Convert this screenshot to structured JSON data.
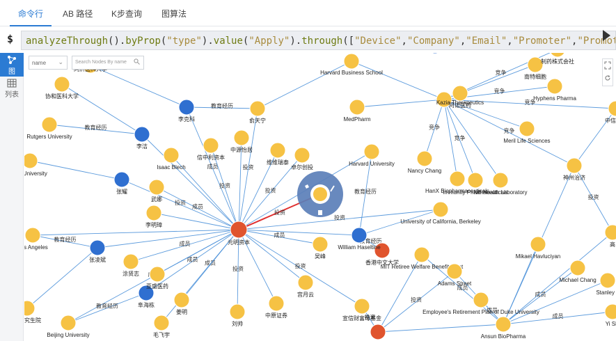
{
  "tabs": [
    {
      "label": "命令行",
      "active": true
    },
    {
      "label": "AB 路径",
      "active": false
    },
    {
      "label": "K步查询",
      "active": false
    },
    {
      "label": "图算法",
      "active": false
    }
  ],
  "command": {
    "prompt": "$",
    "parts": [
      {
        "t": "analyzeThrough",
        "c": "fn"
      },
      {
        "t": "().",
        "c": "p"
      },
      {
        "t": "byProp",
        "c": "fn"
      },
      {
        "t": "(",
        "c": "p"
      },
      {
        "t": "\"type\"",
        "c": "str"
      },
      {
        "t": ").",
        "c": "p"
      },
      {
        "t": "value",
        "c": "fn"
      },
      {
        "t": "(",
        "c": "p"
      },
      {
        "t": "\"Apply\"",
        "c": "str"
      },
      {
        "t": ").",
        "c": "p"
      },
      {
        "t": "through",
        "c": "fn"
      },
      {
        "t": "([",
        "c": "p"
      },
      {
        "t": "\"Device\"",
        "c": "str"
      },
      {
        "t": ",",
        "c": "p"
      },
      {
        "t": "\"Company\"",
        "c": "str"
      },
      {
        "t": ",",
        "c": "p"
      },
      {
        "t": "\"Email\"",
        "c": "str"
      },
      {
        "t": ",",
        "c": "p"
      },
      {
        "t": "\"Promoter\"",
        "c": "str"
      },
      {
        "t": ",",
        "c": "p"
      },
      {
        "t": "\"PromoterAp",
        "c": "str"
      }
    ]
  },
  "sidebar": [
    {
      "icon": "graph-icon",
      "label": "图",
      "active": true
    },
    {
      "icon": "table-icon",
      "label": "列表",
      "active": false
    }
  ],
  "filter": {
    "select_value": "name",
    "search_placeholder": "Search Nodes By name"
  },
  "colors": {
    "company": "#f6c244",
    "person": "#2f6fd0",
    "center": "#e0542e",
    "edge": "#4a90d9",
    "highlight": "#e03030"
  },
  "graph": {
    "nodes": [
      {
        "id": "center",
        "label": "元明资本",
        "kind": "center"
      },
      {
        "id": "c2",
        "label": "香港中文大学",
        "kind": "center"
      },
      {
        "id": "c3",
        "label": "",
        "kind": "center"
      },
      {
        "id": "kazia",
        "label": "Kazia Therapeutics",
        "kind": "company"
      },
      {
        "id": "wh",
        "label": "William Haseltine",
        "kind": "person"
      },
      {
        "id": "ansun",
        "label": "Ansun BioPharma",
        "kind": "company"
      },
      {
        "id": "sel",
        "label": "",
        "kind": "company"
      },
      {
        "id": "lkl",
        "label": "李克科",
        "kind": "person"
      },
      {
        "id": "lj",
        "label": "李洁",
        "kind": "person"
      },
      {
        "id": "zy",
        "label": "张耀",
        "kind": "person"
      },
      {
        "id": "zlb",
        "label": "张凌斌",
        "kind": "person"
      },
      {
        "id": "bhd",
        "label": "阜海栋",
        "kind": "person"
      },
      {
        "id": "p1",
        "label": "",
        "kind": "person"
      },
      {
        "id": "n1",
        "label": "同济医科大学",
        "kind": "company"
      },
      {
        "id": "n2",
        "label": "协和医科大学",
        "kind": "company"
      },
      {
        "id": "n3",
        "label": "Rutgers University",
        "kind": "company"
      },
      {
        "id": "n4",
        "label": "nell University",
        "kind": "company"
      },
      {
        "id": "n5",
        "label": "Isaac Blech",
        "kind": "company"
      },
      {
        "id": "n6",
        "label": "信中利资本",
        "kind": "company"
      },
      {
        "id": "n7",
        "label": "中源怡居",
        "kind": "company"
      },
      {
        "id": "n8",
        "label": "俞天宁",
        "kind": "company"
      },
      {
        "id": "n9",
        "label": "Harvard Business School",
        "kind": "company"
      },
      {
        "id": "n10",
        "label": "MedPharm",
        "kind": "company"
      },
      {
        "id": "n11",
        "label": "维维瑞泰",
        "kind": "company"
      },
      {
        "id": "n12",
        "label": "卓尔创投",
        "kind": "company"
      },
      {
        "id": "n13",
        "label": "Harvard University",
        "kind": "company"
      },
      {
        "id": "n14",
        "label": "Nancy Chang",
        "kind": "company"
      },
      {
        "id": "n15",
        "label": "武娜",
        "kind": "company"
      },
      {
        "id": "n16",
        "label": "李明璋",
        "kind": "company"
      },
      {
        "id": "n17",
        "label": "Los Angeles",
        "kind": "company"
      },
      {
        "id": "n18",
        "label": "涂贤志",
        "kind": "company"
      },
      {
        "id": "n19",
        "label": "亚盛医药",
        "kind": "company"
      },
      {
        "id": "n20",
        "label": "吴峰",
        "kind": "company"
      },
      {
        "id": "n21",
        "label": "宫月云",
        "kind": "company"
      },
      {
        "id": "n22",
        "label": "姜明",
        "kind": "company"
      },
      {
        "id": "n23",
        "label": "毛飞宇",
        "kind": "company"
      },
      {
        "id": "n24",
        "label": "Beijing University",
        "kind": "company"
      },
      {
        "id": "n25",
        "label": "院研究生院",
        "kind": "company"
      },
      {
        "id": "n26",
        "label": "刘帅",
        "kind": "company"
      },
      {
        "id": "n27",
        "label": "中原证券",
        "kind": "company"
      },
      {
        "id": "n28",
        "label": "宣信财富母基金",
        "kind": "company"
      },
      {
        "id": "n29",
        "label": "MIT Retiree Welfare Benefit Trust",
        "kind": "company"
      },
      {
        "id": "n30",
        "label": "Adams Street",
        "kind": "company"
      },
      {
        "id": "n31",
        "label": "Employee's Retirement Plan of Duke University",
        "kind": "company"
      },
      {
        "id": "n32",
        "label": "University of California, Berkeley",
        "kind": "company"
      },
      {
        "id": "n33",
        "label": "HanX Biopharmaceuticals",
        "kind": "company"
      },
      {
        "id": "n34",
        "label": "Immunity Pharmaceuticals",
        "kind": "company"
      },
      {
        "id": "n35",
        "label": "NB Health Laboratory",
        "kind": "company"
      },
      {
        "id": "n36",
        "label": "神州治济",
        "kind": "company"
      },
      {
        "id": "n37",
        "label": "Meril Life Sciences",
        "kind": "company"
      },
      {
        "id": "n38",
        "label": "Hyphens Pharma",
        "kind": "company"
      },
      {
        "id": "n39",
        "label": "南特细胞",
        "kind": "company"
      },
      {
        "id": "n40",
        "label": "制药株式会社",
        "kind": "company"
      },
      {
        "id": "n41",
        "label": "阿诺医药",
        "kind": "company"
      },
      {
        "id": "n42",
        "label": "Mikael Havluciyan",
        "kind": "company"
      },
      {
        "id": "n43",
        "label": "Michael Chang",
        "kind": "company"
      },
      {
        "id": "n44",
        "label": "Stanley L",
        "kind": "company"
      },
      {
        "id": "n45",
        "label": "Yi Shi",
        "kind": "company"
      },
      {
        "id": "n46",
        "label": "高",
        "kind": "company"
      },
      {
        "id": "n47",
        "label": "中信产业",
        "kind": "company"
      }
    ],
    "edges": [
      {
        "label": "教育经历"
      },
      {
        "label": "投资"
      },
      {
        "label": "成员"
      },
      {
        "label": "竞争"
      }
    ]
  }
}
